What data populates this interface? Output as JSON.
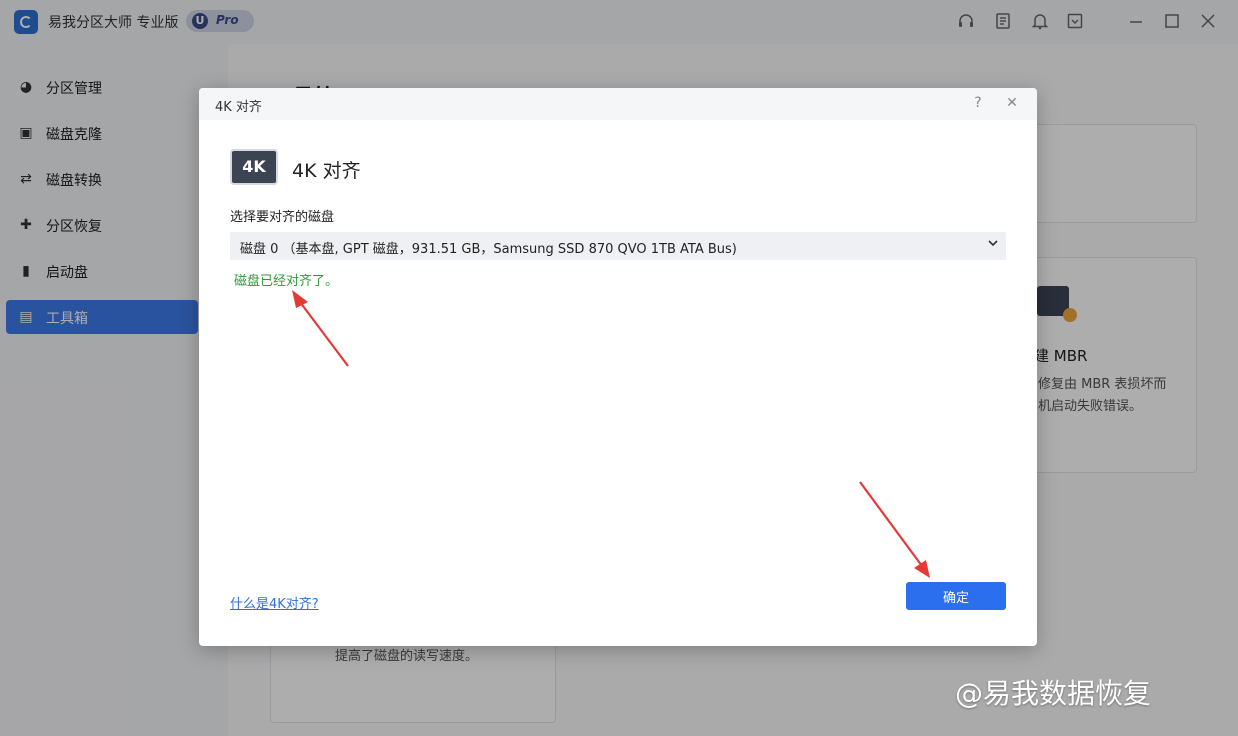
{
  "app": {
    "title": "易我分区大师 专业版",
    "badge_letter": "U",
    "badge_text": "Pro",
    "accent_color": "#2b6fee"
  },
  "titlebar_icons": [
    "headset-icon",
    "note-icon",
    "bell-icon",
    "download-box-icon",
    "minimize-icon",
    "maximize-icon",
    "close-icon"
  ],
  "sidebar": {
    "items": [
      {
        "label": "分区管理",
        "icon": "pie-icon",
        "active": false
      },
      {
        "label": "磁盘克隆",
        "icon": "clone-icon",
        "active": false
      },
      {
        "label": "磁盘转换",
        "icon": "convert-icon",
        "active": false
      },
      {
        "label": "分区恢复",
        "icon": "recover-icon",
        "active": false
      },
      {
        "label": "启动盘",
        "icon": "usb-icon",
        "active": false
      },
      {
        "label": "工具箱",
        "icon": "toolbox-icon",
        "active": true
      }
    ]
  },
  "main": {
    "page_title": "工具箱",
    "card_mbr": {
      "title": "建 MBR",
      "desc_line1": "修复由 MBR 表损坏而",
      "desc_line2": "机启动失败错误。"
    },
    "card_bottom": {
      "desc": "提高了磁盘的读写速度。"
    }
  },
  "dialog": {
    "header_title": "4K 对齐",
    "help_symbol": "?",
    "close_symbol": "✕",
    "badge_text": "4K",
    "heading": "4K 对齐",
    "select_label": "选择要对齐的磁盘",
    "disk_selected": "磁盘 0 （基本盘, GPT 磁盘，931.51 GB，Samsung SSD 870 QVO 1TB ATA Bus)",
    "status_text": "磁盘已经对齐了。",
    "status_color": "#2e9a3a",
    "help_link": "什么是4K对齐?",
    "ok_label": "确定"
  },
  "watermark": "@易我数据恢复",
  "annotation_color": "#e53935"
}
